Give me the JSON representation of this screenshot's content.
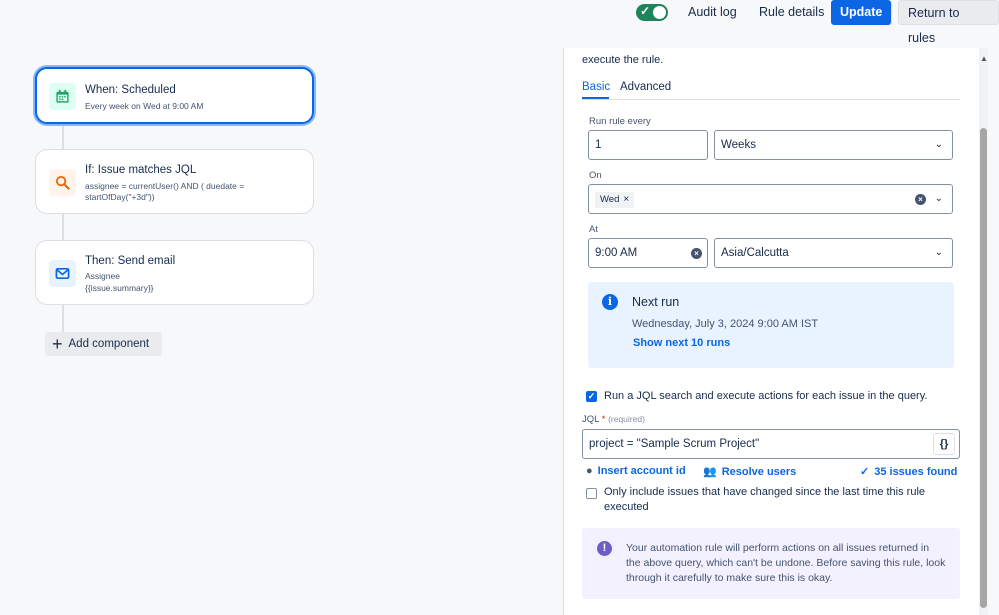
{
  "topbar": {
    "toggle_state": "on",
    "audit_log": "Audit log",
    "rule_details": "Rule details",
    "update": "Update",
    "return_to_rules": "Return to rules"
  },
  "flow": {
    "components": [
      {
        "title": "When: Scheduled",
        "subtitle": "Every week on Wed at 9:00 AM",
        "icon": "calendar-icon",
        "color": "#22a06b"
      },
      {
        "title": "If: Issue matches JQL",
        "subtitle": "assignee = currentUser() AND ( duedate = startOfDay(\"+3d\"))",
        "icon": "search-icon",
        "color": "#e56910"
      },
      {
        "title": "Then: Send email",
        "subtitle_line1": "Assignee",
        "subtitle_line2": "{{issue.summary}}",
        "icon": "mail-icon",
        "color": "#0c66e4"
      }
    ],
    "add_component": "Add component"
  },
  "panel": {
    "description": "execute the rule.",
    "tabs": [
      "Basic",
      "Advanced"
    ],
    "active_tab": "Basic",
    "run_every_label": "Run rule every",
    "run_every_value": "1",
    "run_every_unit": "Weeks",
    "on_label": "On",
    "on_days": [
      "Wed"
    ],
    "at_label": "At",
    "at_time": "9:00 AM",
    "timezone": "Asia/Calcutta",
    "next_run": {
      "title": "Next run",
      "date": "Wednesday, July 3, 2024 9:00 AM IST",
      "link": "Show next 10 runs"
    },
    "jql_checkbox": {
      "label": "Run a JQL search and execute actions for each issue in the query.",
      "checked": true
    },
    "jql_label": "JQL",
    "jql_required_mark": "*",
    "jql_required_text": "(required)",
    "jql_value": "project = \"Sample Scrum Project\"",
    "jql_button": "{}",
    "insert_account_id": "Insert account id",
    "resolve_users": "Resolve users",
    "issues_found": "35 issues found",
    "changed_checkbox": {
      "label_line1": "Only include issues that have changed since the last time this rule",
      "label_line2": "executed",
      "checked": false
    },
    "warning": "Your automation rule will perform actions on all issues returned in the above query, which can't be undone. Before saving this rule, look through it carefully to make sure this is okay."
  },
  "colors": {
    "accent": "#0c66e4",
    "success": "#1f845a",
    "info_bg": "#e9f2ff",
    "discovery_bg": "#f3f0ff"
  }
}
